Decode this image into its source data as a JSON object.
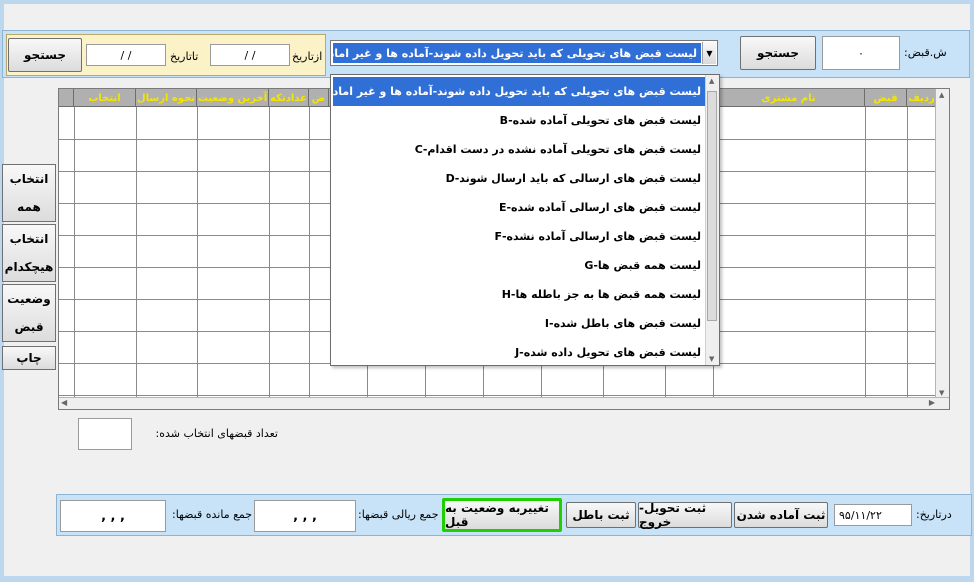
{
  "top_filter": {
    "receipt_no_label": "ش.قبض:",
    "receipt_no_value": "٠",
    "search_button_right": "جستجو",
    "search_button_left": "جستجو",
    "from_date_label": "ازتاریخ",
    "from_date_value": "/ /",
    "to_date_label": "تاتاریخ",
    "to_date_value": "/ /",
    "selected_list": "لیست قبض های تحویلی که باید تحویل داده شوند-آماده ها و غیر اماده ها-A"
  },
  "dropdown_items": [
    "لیست قبض های تحویلی که باید تحویل داده شوند-آماده ها و غیر اماده ها-A",
    "لیست قبض های تحویلی آماده شده-B",
    "لیست قبض های تحویلی آماده نشده در دست اقدام-C",
    "لیست قبض های ارسالی که باید ارسال شوند-D",
    "لیست قبض های ارسالی آماده شده-E",
    "لیست قبض های ارسالی آماده نشده-F",
    "لیست همه قبض ها-G",
    "لیست همه قبض ها به جز باطله ها-H",
    "لیست قبض های باطل شده-I",
    "لیست قبض های تحویل داده شده-J"
  ],
  "grid": {
    "columns": [
      "ردیف",
      "قبض",
      "نام مشتری",
      "ض",
      "عدادتکه",
      "آخرین وضعیت",
      "نحوه ارسال",
      "انتخاب"
    ]
  },
  "side_buttons": {
    "select_all": [
      "انتخاب",
      "همه"
    ],
    "select_none": [
      "انتخاب",
      "هیچکدام"
    ],
    "receipt_status": [
      "وضعیت",
      "قبض"
    ],
    "print": "چاپ"
  },
  "selected_count_label": "تعداد قبضهای انتخاب شده:",
  "bottom": {
    "date_label": "درتاریخ:",
    "date_value": "۹۵/۱۱/۲۲",
    "btn_register_ready": "ثبت آماده شدن",
    "btn_register_delivery": "ثبت تحویل-خروج",
    "btn_register_void": "ثبت باطل",
    "btn_revert_status": "تغییربه وضعیت به قبل",
    "total_rial_label": "جمع ریالی قبضها:",
    "total_rial_value": ", , ,",
    "remaining_label": "جمع مانده قبضها:",
    "remaining_value": ", , ,"
  }
}
